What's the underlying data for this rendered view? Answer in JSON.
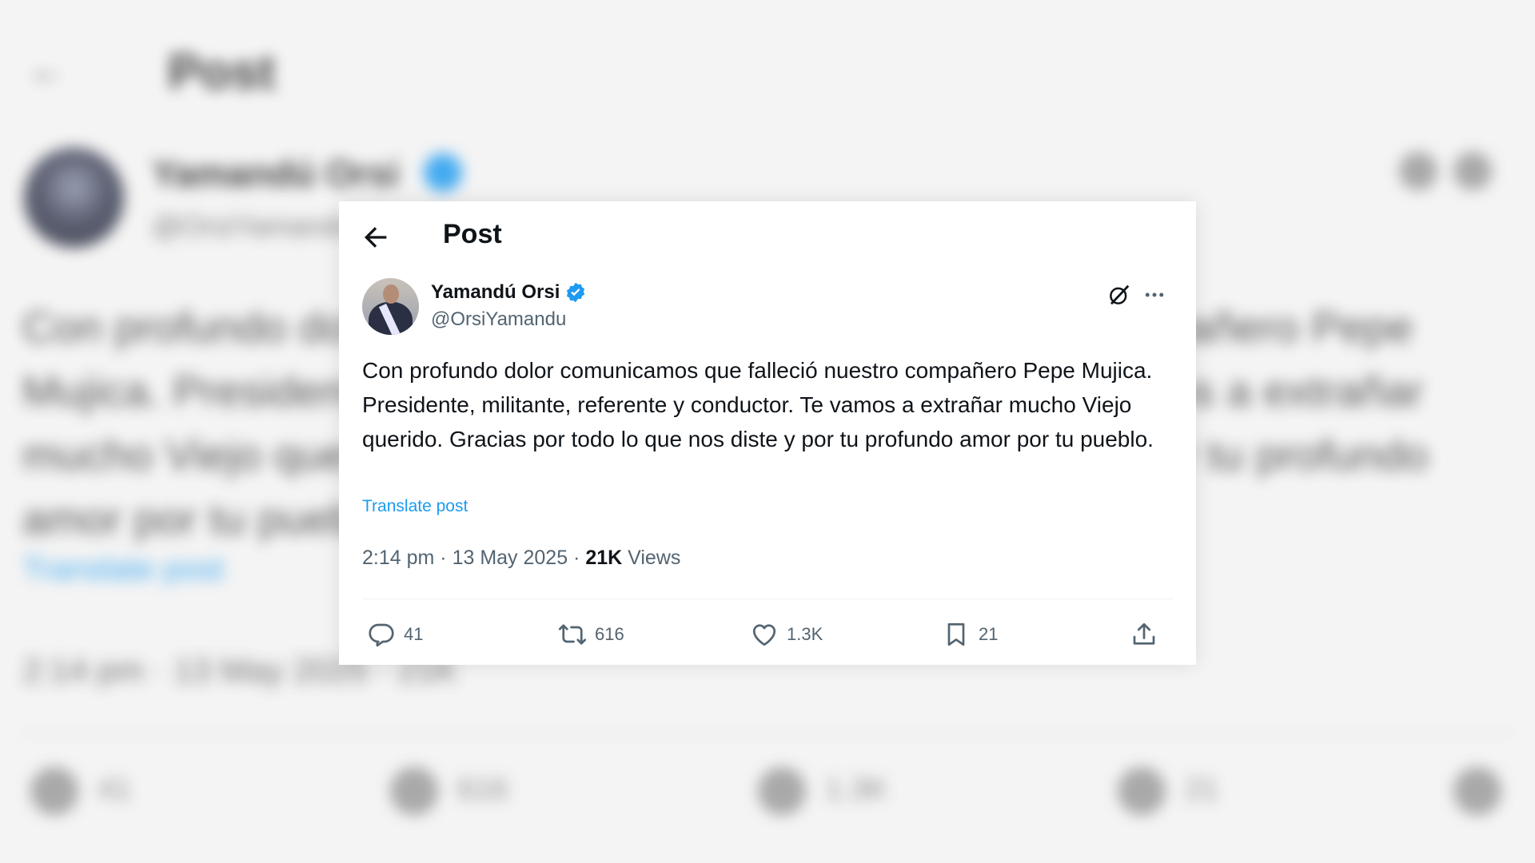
{
  "header": {
    "title": "Post"
  },
  "author": {
    "name": "Yamandú Orsi",
    "handle": "@OrsiYamandu"
  },
  "post": {
    "text": "Con profundo dolor comunicamos que falleció nuestro compañero Pepe Mujica. Presidente, militante, referente y conductor. Te vamos a extrañar mucho Viejo querido. Gracias por todo lo que nos diste y por tu profundo amor por tu pueblo.",
    "translate_label": "Translate post",
    "time": "2:14 pm",
    "date": "13 May 2025",
    "views_count": "21K",
    "views_label": "Views"
  },
  "actions": {
    "replies": "41",
    "reposts": "616",
    "likes": "1.3K",
    "bookmarks": "21"
  },
  "colors": {
    "accent": "#1d9bf0",
    "text_primary": "#0f1419",
    "text_secondary": "#536471"
  },
  "icons": [
    "back-arrow-icon",
    "verified-badge-icon",
    "grok-icon",
    "more-icon",
    "reply-icon",
    "repost-icon",
    "like-icon",
    "bookmark-icon",
    "share-icon"
  ]
}
